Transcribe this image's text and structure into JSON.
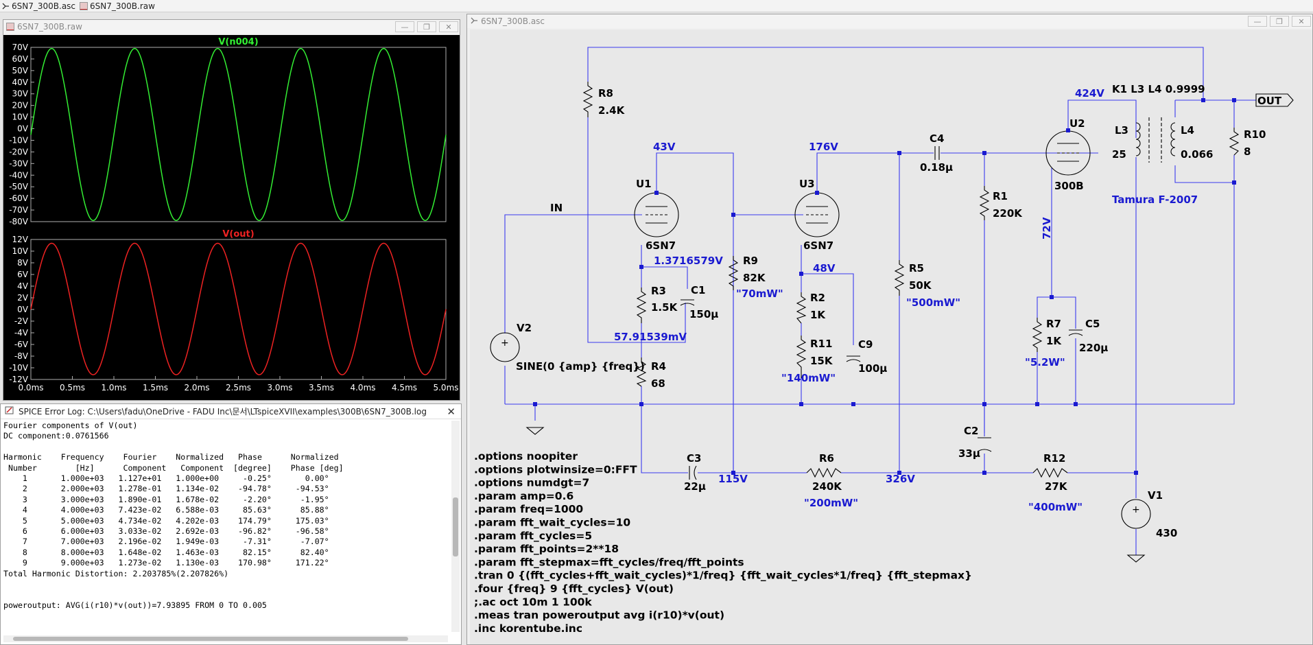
{
  "tabs": [
    {
      "label": "6SN7_300B.asc",
      "icon": "schematic-icon"
    },
    {
      "label": "6SN7_300B.raw",
      "icon": "waveform-icon"
    }
  ],
  "waveform_window": {
    "title": "6SN7_300B.raw",
    "buttons": {
      "minimize": "—",
      "restore": "❐",
      "close": "✕"
    }
  },
  "schematic_window": {
    "title": "6SN7_300B.asc",
    "buttons": {
      "minimize": "—",
      "restore": "❐",
      "close": "✕"
    }
  },
  "chart_data": [
    {
      "type": "line",
      "title": "V(n004)",
      "x": {
        "min": 0,
        "max": 5,
        "unit": "ms"
      },
      "ylim": [
        -80,
        70
      ],
      "yticks": [
        "70V",
        "60V",
        "50V",
        "40V",
        "30V",
        "20V",
        "10V",
        "0V",
        "-10V",
        "-20V",
        "-30V",
        "-40V",
        "-50V",
        "-60V",
        "-70V",
        "-80V"
      ],
      "series": [
        {
          "name": "V(n004)",
          "color": "#33ee33",
          "amplitude": 74,
          "offset": -5,
          "frequency_khz": 1,
          "phase_deg": -0.25
        }
      ],
      "grid": false
    },
    {
      "type": "line",
      "title": "V(out)",
      "x": {
        "min": 0,
        "max": 5,
        "unit": "ms"
      },
      "ylim": [
        -12,
        12
      ],
      "yticks": [
        "12V",
        "10V",
        "8V",
        "6V",
        "4V",
        "2V",
        "0V",
        "-2V",
        "-4V",
        "-6V",
        "-8V",
        "-10V",
        "-12V"
      ],
      "xticks": [
        "0.0ms",
        "0.5ms",
        "1.0ms",
        "1.5ms",
        "2.0ms",
        "2.5ms",
        "3.0ms",
        "3.5ms",
        "4.0ms",
        "4.5ms",
        "5.0ms"
      ],
      "series": [
        {
          "name": "V(out)",
          "color": "#ee2222",
          "amplitude": 11.27,
          "offset": 0.08,
          "frequency_khz": 1,
          "phase_deg": -0.25
        }
      ],
      "grid": false
    }
  ],
  "error_log": {
    "title": "SPICE Error Log: C:\\Users\\fadu\\OneDrive - FADU Inc\\문서\\LTspiceXVII\\examples\\300B\\6SN7_300B.log",
    "lines": [
      "Fourier components of V(out)",
      "DC component:0.0761566",
      "",
      "Harmonic    Frequency    Fourier    Normalized   Phase      Normalized",
      " Number        [Hz]      Component   Component  [degree]    Phase [deg]",
      "    1       1.000e+03   1.127e+01   1.000e+00     -0.25°       0.00°",
      "    2       2.000e+03   1.278e-01   1.134e-02    -94.78°     -94.53°",
      "    3       3.000e+03   1.890e-01   1.678e-02     -2.20°      -1.95°",
      "    4       4.000e+03   7.423e-02   6.588e-03     85.63°      85.88°",
      "    5       5.000e+03   4.734e-02   4.202e-03    174.79°     175.03°",
      "    6       6.000e+03   3.033e-02   2.692e-03    -96.82°     -96.58°",
      "    7       7.000e+03   2.196e-02   1.949e-03     -7.31°      -7.07°",
      "    8       8.000e+03   1.648e-02   1.463e-03     82.15°      82.40°",
      "    9       9.000e+03   1.273e-02   1.130e-03    170.98°     171.22°",
      "Total Harmonic Distortion: 2.203785%(2.207826%)",
      "",
      "",
      "poweroutput: AVG(i(r10)*v(out))=7.93895 FROM 0 TO 0.005"
    ]
  },
  "schematic": {
    "components": {
      "R8": {
        "name": "R8",
        "value": "2.4K"
      },
      "R9": {
        "name": "R9",
        "value": "82K",
        "power": "\"70mW\""
      },
      "R3": {
        "name": "R3",
        "value": "1.5K"
      },
      "R4": {
        "name": "R4",
        "value": "68"
      },
      "C1": {
        "name": "C1",
        "value": "150µ"
      },
      "R2": {
        "name": "R2",
        "value": "1K"
      },
      "R11": {
        "name": "R11",
        "value": "15K",
        "power": "\"140mW\""
      },
      "C9": {
        "name": "C9",
        "value": "100µ"
      },
      "R5": {
        "name": "R5",
        "value": "50K",
        "power": "\"500mW\""
      },
      "C4": {
        "name": "C4",
        "value": "0.18µ"
      },
      "R1": {
        "name": "R1",
        "value": "220K"
      },
      "R7": {
        "name": "R7",
        "value": "1K",
        "power": "\"5.2W\""
      },
      "C5": {
        "name": "C5",
        "value": "220µ"
      },
      "C2": {
        "name": "C2",
        "value": "33µ"
      },
      "C3": {
        "name": "C3",
        "value": "22µ"
      },
      "R6": {
        "name": "R6",
        "value": "240K",
        "power": "\"200mW\""
      },
      "R12": {
        "name": "R12",
        "value": "27K",
        "power": "\"400mW\""
      },
      "R10": {
        "name": "R10",
        "value": "8"
      },
      "L3": {
        "name": "L3",
        "value": "25"
      },
      "L4": {
        "name": "L4",
        "value": "0.066"
      },
      "U1": {
        "name": "U1",
        "value": "6SN7"
      },
      "U3": {
        "name": "U3",
        "value": "6SN7"
      },
      "U2": {
        "name": "U2",
        "value": "300B"
      },
      "V1": {
        "name": "V1",
        "value": "430"
      },
      "V2": {
        "name": "V2",
        "value": "SINE(0 {amp} {freq})"
      }
    },
    "nodes": {
      "n43": "43V",
      "n176": "176V",
      "n424": "424V",
      "n72": "72V",
      "n137": "1.3716579V",
      "n57": "57.91539mV",
      "n48": "48V",
      "n115": "115V",
      "n326": "326V",
      "in": "IN",
      "out": "OUT"
    },
    "coupling": "K1 L3 L4 0.9999",
    "transformer_label": "Tamura F-2007",
    "directives": [
      ".options noopiter",
      ".options plotwinsize=0:FFT",
      ".options numdgt=7",
      ".param amp=0.6",
      ".param freq=1000",
      ".param fft_wait_cycles=10",
      ".param fft_cycles=5",
      ".param fft_points=2**18",
      ".param fft_stepmax=fft_cycles/freq/fft_points",
      ".tran 0 {(fft_cycles+fft_wait_cycles)*1/freq} {fft_wait_cycles*1/freq} {fft_stepmax}",
      ".four {freq} 9 {fft_cycles} V(out)",
      ";.ac oct 10m 1 100k",
      ".meas tran poweroutput avg i(r10)*v(out)",
      ".inc korentube.inc"
    ]
  }
}
